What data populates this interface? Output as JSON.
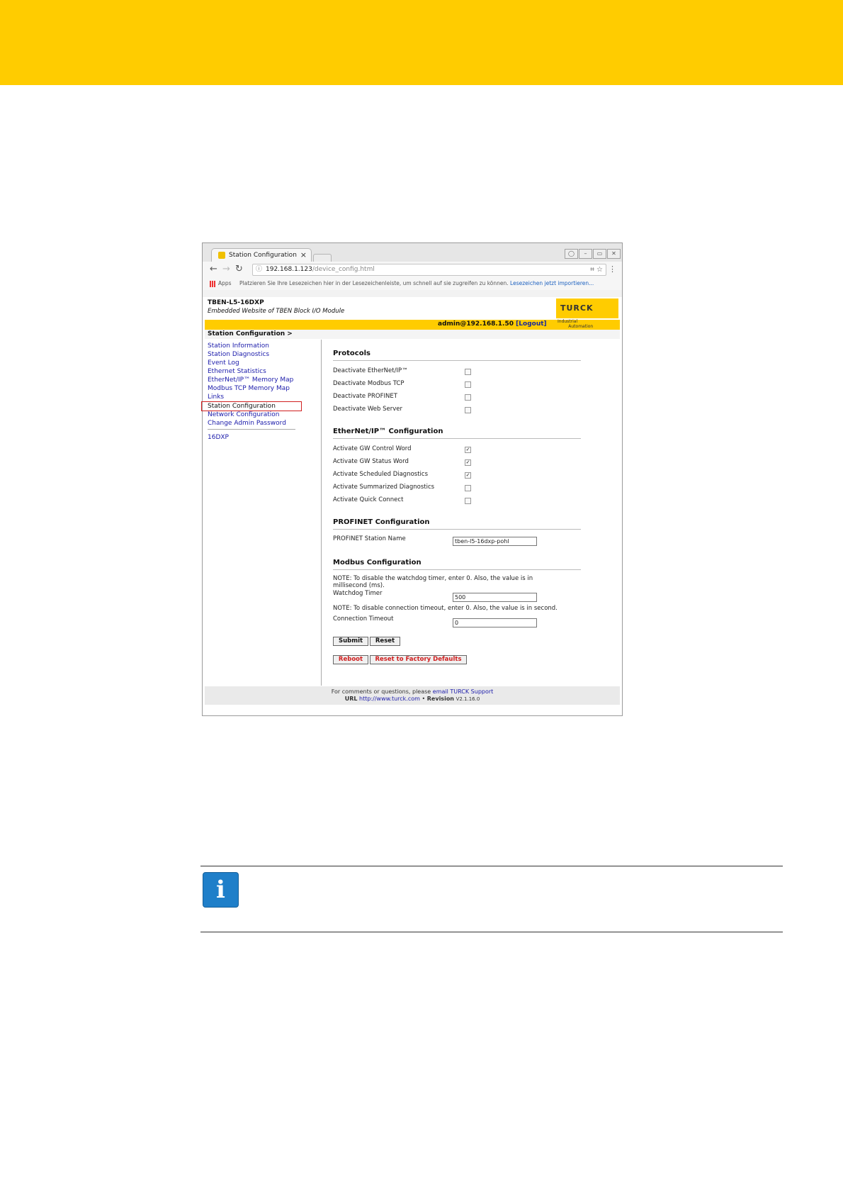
{
  "browser": {
    "tab_title": "Station Configuration",
    "url_host": "192.168.1.123",
    "url_path": "/device_config.html",
    "apps_label": "Apps",
    "bookmark_msg": "Platzieren Sie Ihre Lesezeichen hier in der Lesezeichenleiste, um schnell auf sie zugreifen zu können.",
    "bookmark_link": "Lesezeichen jetzt importieren..."
  },
  "page": {
    "device": "TBEN-L5-16DXP",
    "subtitle": "Embedded Website of TBEN Block I/O Module",
    "logo": "TURCK",
    "logo_sub1": "Industrial",
    "logo_sub2": "Automation",
    "admin": "admin@192.168.1.50",
    "logout": "[Logout]",
    "breadcrumb": "Station Configuration >"
  },
  "sidebar": {
    "items": [
      "Station Information",
      "Station Diagnostics",
      "Event Log",
      "Ethernet Statistics",
      "EtherNet/IP™ Memory Map",
      "Modbus TCP Memory Map",
      "Links",
      "Station Configuration",
      "Network Configuration",
      "Change Admin Password"
    ],
    "module": "16DXP"
  },
  "protocols": {
    "heading": "Protocols",
    "items": [
      {
        "label": "Deactivate EtherNet/IP™",
        "checked": false
      },
      {
        "label": "Deactivate Modbus TCP",
        "checked": false
      },
      {
        "label": "Deactivate PROFINET",
        "checked": false
      },
      {
        "label": "Deactivate Web Server",
        "checked": false
      }
    ]
  },
  "ethernetip": {
    "heading": "EtherNet/IP™ Configuration",
    "items": [
      {
        "label": "Activate GW Control Word",
        "checked": true
      },
      {
        "label": "Activate GW Status Word",
        "checked": true
      },
      {
        "label": "Activate Scheduled Diagnostics",
        "checked": true
      },
      {
        "label": "Activate Summarized Diagnostics",
        "checked": false
      },
      {
        "label": "Activate Quick Connect",
        "checked": false
      }
    ]
  },
  "profinet": {
    "heading": "PROFINET Configuration",
    "station_label": "PROFINET Station Name",
    "station_value": "tben-l5-16dxp-pohl"
  },
  "modbus": {
    "heading": "Modbus Configuration",
    "note1": "NOTE: To disable the watchdog timer, enter 0. Also, the value is in",
    "note1b": "millisecond (ms).",
    "watchdog_label": "Watchdog Timer",
    "watchdog_value": "500",
    "note2": "NOTE: To disable connection timeout, enter 0. Also, the value is in second.",
    "timeout_label": "Connection Timeout",
    "timeout_value": "0"
  },
  "buttons": {
    "submit": "Submit",
    "reset": "Reset",
    "reboot": "Reboot",
    "factory": "Reset to Factory Defaults"
  },
  "footer": {
    "line1_text": "For comments or questions, please",
    "line1_link": "email TURCK Support",
    "url_label": "URL",
    "url": "http://www.turck.com",
    "sep": "•",
    "revision_label": "Revision",
    "revision": "V2.1.16.0"
  },
  "colors": {
    "brand_yellow": "#ffcc00",
    "selection_red": "#d01f1f",
    "info_blue": "#1f7fc9"
  },
  "icons": [
    "back-arrow-icon",
    "forward-arrow-icon",
    "reload-icon",
    "info-icon",
    "star-icon",
    "menu-icon",
    "info-note-icon"
  ]
}
